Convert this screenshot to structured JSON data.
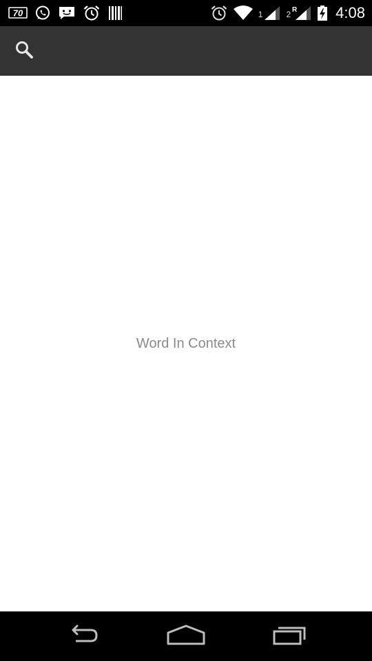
{
  "status_bar": {
    "left_icons": [
      "seventy-badge-icon",
      "whatsapp-icon",
      "messaging-icon",
      "alarm-icon",
      "barcode-icon"
    ],
    "badge_text": "70",
    "right_icons": [
      "alarm-icon",
      "wifi-icon",
      "signal-sim1-icon",
      "signal-sim2-roaming-icon",
      "battery-charging-icon"
    ],
    "sim1_label": "1",
    "sim2_label": "2",
    "roaming_label": "R",
    "time": "4:08"
  },
  "action_bar": {
    "search_icon": "search-icon",
    "background": "#333333"
  },
  "main": {
    "empty_text": "Word In Context",
    "background": "#ffffff",
    "text_color": "#8a8a8a"
  },
  "nav_bar": {
    "buttons": [
      "back-icon",
      "home-icon",
      "recent-apps-icon"
    ]
  }
}
